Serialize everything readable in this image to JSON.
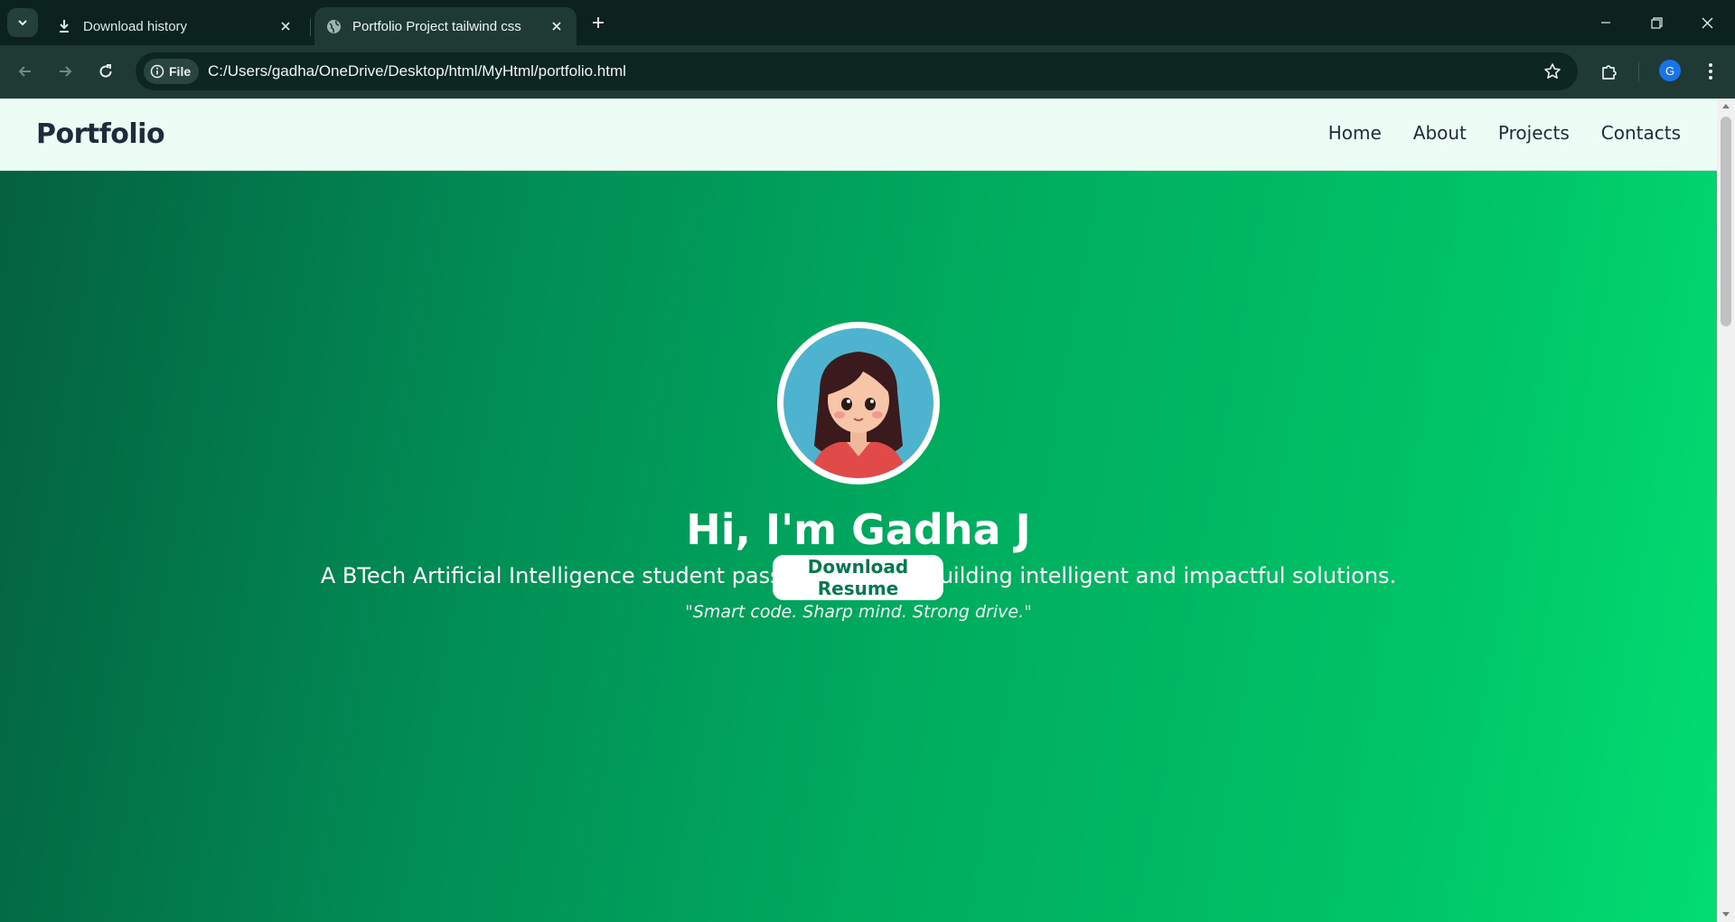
{
  "browser": {
    "tabs": [
      {
        "title": "Download history",
        "icon": "download-icon",
        "active": false
      },
      {
        "title": "Portfolio Project tailwind css",
        "icon": "globe-icon",
        "active": true
      }
    ],
    "address_chip": "File",
    "url": "C:/Users/gadha/OneDrive/Desktop/html/MyHtml/portfolio.html",
    "profile_initial": "G"
  },
  "site": {
    "brand": "Portfolio",
    "nav": [
      "Home",
      "About",
      "Projects",
      "Contacts"
    ],
    "hero": {
      "title": "Hi, I'm Gadha J",
      "subtitle": "A BTech Artificial Intelligence student passionate about building intelligent and impactful solutions.",
      "quote": "\"Smart code. Sharp mind. Strong drive.\"",
      "button": "Download Resume"
    }
  },
  "colors": {
    "nav_bg": "#ecfdf5",
    "hero_start": "#04613f",
    "hero_end": "#02dd72",
    "button_text": "#047a4c"
  }
}
